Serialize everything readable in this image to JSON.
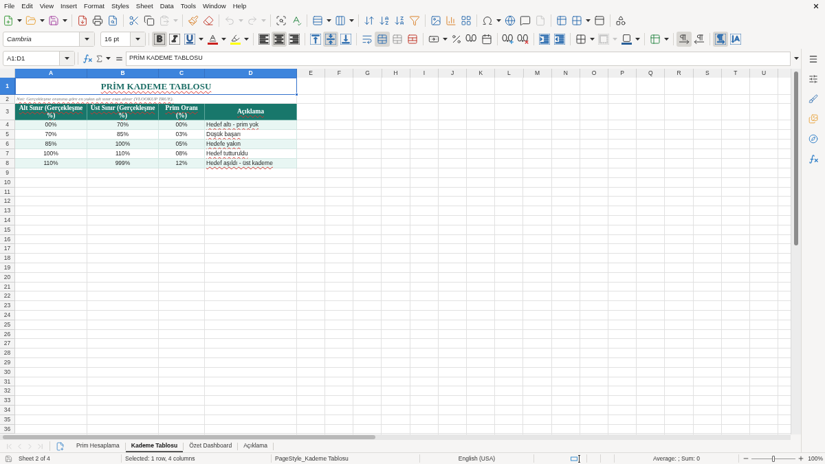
{
  "menu_bar": {
    "items": [
      "File",
      "Edit",
      "View",
      "Insert",
      "Format",
      "Styles",
      "Sheet",
      "Data",
      "Tools",
      "Window",
      "Help"
    ]
  },
  "standard_toolbar": {
    "paste_disabled": true,
    "undo_disabled": true,
    "redo_disabled": true,
    "header_footer_disabled": true
  },
  "formatting_toolbar": {
    "font_name": "Cambria",
    "font_size": "16 pt",
    "bold": true,
    "italic": false,
    "underline": false,
    "align_left": false,
    "align_center": true,
    "align_right": false,
    "align_top": false,
    "align_middle": true,
    "align_bottom": false,
    "merge_and_center": true,
    "border_style_disabled": true,
    "left_to_right": true,
    "right_to_left": false,
    "text_horizontal": true,
    "text_vertical": false
  },
  "formula_bar": {
    "name_box": "A1:D1",
    "content": "PRİM KADEME TABLOSU"
  },
  "sheet": {
    "autospell_marks": true,
    "columns": [
      {
        "label": "A",
        "selected": true
      },
      {
        "label": "B",
        "selected": true
      },
      {
        "label": "C",
        "selected": true
      },
      {
        "label": "D",
        "selected": true
      },
      {
        "label": "E",
        "selected": false
      },
      {
        "label": "F",
        "selected": false
      },
      {
        "label": "G",
        "selected": false
      },
      {
        "label": "H",
        "selected": false
      },
      {
        "label": "I",
        "selected": false
      },
      {
        "label": "J",
        "selected": false
      },
      {
        "label": "K",
        "selected": false
      },
      {
        "label": "L",
        "selected": false
      },
      {
        "label": "M",
        "selected": false
      },
      {
        "label": "N",
        "selected": false
      },
      {
        "label": "O",
        "selected": false
      },
      {
        "label": "P",
        "selected": false
      },
      {
        "label": "Q",
        "selected": false
      },
      {
        "label": "R",
        "selected": false
      },
      {
        "label": "S",
        "selected": false
      },
      {
        "label": "T",
        "selected": false
      },
      {
        "label": "U",
        "selected": false
      }
    ],
    "row_numbers": [
      {
        "label": "1",
        "selected": true
      },
      {
        "label": "2",
        "selected": false
      },
      {
        "label": "3",
        "selected": false
      },
      {
        "label": "4",
        "selected": false
      },
      {
        "label": "5",
        "selected": false
      },
      {
        "label": "6",
        "selected": false
      },
      {
        "label": "7",
        "selected": false
      },
      {
        "label": "8",
        "selected": false
      },
      {
        "label": "9",
        "selected": false
      },
      {
        "label": "10",
        "selected": false
      },
      {
        "label": "11",
        "selected": false
      },
      {
        "label": "12",
        "selected": false
      },
      {
        "label": "13",
        "selected": false
      },
      {
        "label": "14",
        "selected": false
      },
      {
        "label": "15",
        "selected": false
      },
      {
        "label": "16",
        "selected": false
      },
      {
        "label": "17",
        "selected": false
      },
      {
        "label": "18",
        "selected": false
      },
      {
        "label": "19",
        "selected": false
      },
      {
        "label": "20",
        "selected": false
      },
      {
        "label": "21",
        "selected": false
      },
      {
        "label": "22",
        "selected": false
      },
      {
        "label": "23",
        "selected": false
      },
      {
        "label": "24",
        "selected": false
      },
      {
        "label": "25",
        "selected": false
      },
      {
        "label": "26",
        "selected": false
      },
      {
        "label": "27",
        "selected": false
      },
      {
        "label": "28",
        "selected": false
      },
      {
        "label": "29",
        "selected": false
      },
      {
        "label": "30",
        "selected": false
      },
      {
        "label": "31",
        "selected": false
      },
      {
        "label": "32",
        "selected": false
      },
      {
        "label": "33",
        "selected": false
      },
      {
        "label": "34",
        "selected": false
      },
      {
        "label": "35",
        "selected": false
      },
      {
        "label": "36",
        "selected": false
      }
    ],
    "title": "PRİM KADEME TABLOSU",
    "note": "Not: Gerçekleşme oranına göre en yakın alt sınır esas alınır (VLOOKUP TRUE).",
    "table": {
      "columns": [
        "Alt Sınır (Gerçekleşme %)",
        "Üst Sınır (Gerçekleşme %)",
        "Prim Oranı (%)",
        "Açıklama"
      ],
      "rows": [
        [
          "00%",
          "70%",
          "00%",
          "Hedef altı - prim yok"
        ],
        [
          "70%",
          "85%",
          "03%",
          "Düşük başarı"
        ],
        [
          "85%",
          "100%",
          "05%",
          "Hedefe yakın"
        ],
        [
          "100%",
          "110%",
          "08%",
          "Hedef tutturuldu"
        ],
        [
          "110%",
          "999%",
          "12%",
          "Hedef aşıldı - üst kademe"
        ]
      ]
    }
  },
  "sheet_tabs": {
    "navigation_disabled": true,
    "tabs": [
      {
        "label": "Prim Hesaplama",
        "selected": false
      },
      {
        "label": "Kademe Tablosu",
        "selected": true
      },
      {
        "label": "Özet Dashboard",
        "selected": false
      },
      {
        "label": "Açıklama",
        "selected": false
      }
    ]
  },
  "status_bar": {
    "sheet_position": "Sheet 2 of 4",
    "selection": "Selected: 1 row, 4 columns",
    "page_style": "PageStyle_Kademe Tablosu",
    "language": "English (USA)",
    "statistics": "Average: ; Sum: 0",
    "zoom": {
      "level": 0.5,
      "reading": "100%"
    }
  }
}
